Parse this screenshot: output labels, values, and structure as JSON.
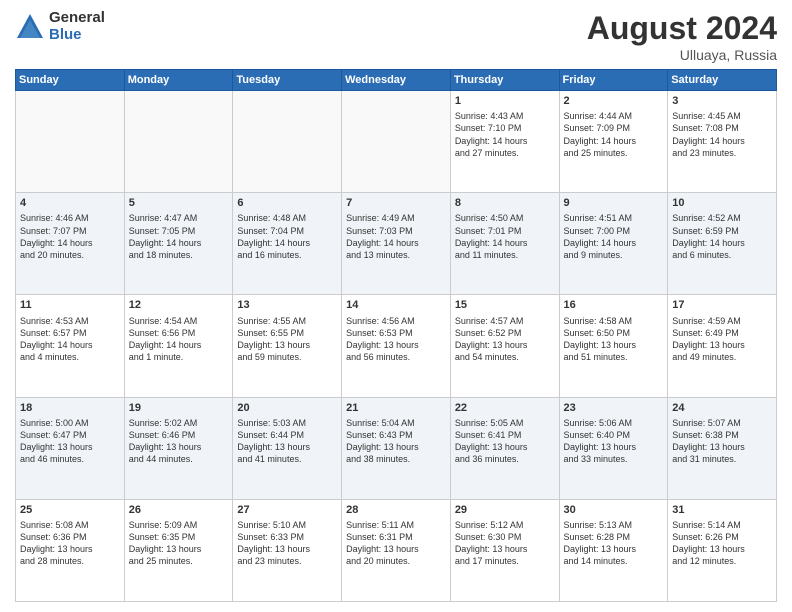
{
  "header": {
    "logo_general": "General",
    "logo_blue": "Blue",
    "month_title": "August 2024",
    "location": "Ulluaya, Russia"
  },
  "days_of_week": [
    "Sunday",
    "Monday",
    "Tuesday",
    "Wednesday",
    "Thursday",
    "Friday",
    "Saturday"
  ],
  "weeks": [
    [
      {
        "day": "",
        "info": ""
      },
      {
        "day": "",
        "info": ""
      },
      {
        "day": "",
        "info": ""
      },
      {
        "day": "",
        "info": ""
      },
      {
        "day": "1",
        "info": "Sunrise: 4:43 AM\nSunset: 7:10 PM\nDaylight: 14 hours\nand 27 minutes."
      },
      {
        "day": "2",
        "info": "Sunrise: 4:44 AM\nSunset: 7:09 PM\nDaylight: 14 hours\nand 25 minutes."
      },
      {
        "day": "3",
        "info": "Sunrise: 4:45 AM\nSunset: 7:08 PM\nDaylight: 14 hours\nand 23 minutes."
      }
    ],
    [
      {
        "day": "4",
        "info": "Sunrise: 4:46 AM\nSunset: 7:07 PM\nDaylight: 14 hours\nand 20 minutes."
      },
      {
        "day": "5",
        "info": "Sunrise: 4:47 AM\nSunset: 7:05 PM\nDaylight: 14 hours\nand 18 minutes."
      },
      {
        "day": "6",
        "info": "Sunrise: 4:48 AM\nSunset: 7:04 PM\nDaylight: 14 hours\nand 16 minutes."
      },
      {
        "day": "7",
        "info": "Sunrise: 4:49 AM\nSunset: 7:03 PM\nDaylight: 14 hours\nand 13 minutes."
      },
      {
        "day": "8",
        "info": "Sunrise: 4:50 AM\nSunset: 7:01 PM\nDaylight: 14 hours\nand 11 minutes."
      },
      {
        "day": "9",
        "info": "Sunrise: 4:51 AM\nSunset: 7:00 PM\nDaylight: 14 hours\nand 9 minutes."
      },
      {
        "day": "10",
        "info": "Sunrise: 4:52 AM\nSunset: 6:59 PM\nDaylight: 14 hours\nand 6 minutes."
      }
    ],
    [
      {
        "day": "11",
        "info": "Sunrise: 4:53 AM\nSunset: 6:57 PM\nDaylight: 14 hours\nand 4 minutes."
      },
      {
        "day": "12",
        "info": "Sunrise: 4:54 AM\nSunset: 6:56 PM\nDaylight: 14 hours\nand 1 minute."
      },
      {
        "day": "13",
        "info": "Sunrise: 4:55 AM\nSunset: 6:55 PM\nDaylight: 13 hours\nand 59 minutes."
      },
      {
        "day": "14",
        "info": "Sunrise: 4:56 AM\nSunset: 6:53 PM\nDaylight: 13 hours\nand 56 minutes."
      },
      {
        "day": "15",
        "info": "Sunrise: 4:57 AM\nSunset: 6:52 PM\nDaylight: 13 hours\nand 54 minutes."
      },
      {
        "day": "16",
        "info": "Sunrise: 4:58 AM\nSunset: 6:50 PM\nDaylight: 13 hours\nand 51 minutes."
      },
      {
        "day": "17",
        "info": "Sunrise: 4:59 AM\nSunset: 6:49 PM\nDaylight: 13 hours\nand 49 minutes."
      }
    ],
    [
      {
        "day": "18",
        "info": "Sunrise: 5:00 AM\nSunset: 6:47 PM\nDaylight: 13 hours\nand 46 minutes."
      },
      {
        "day": "19",
        "info": "Sunrise: 5:02 AM\nSunset: 6:46 PM\nDaylight: 13 hours\nand 44 minutes."
      },
      {
        "day": "20",
        "info": "Sunrise: 5:03 AM\nSunset: 6:44 PM\nDaylight: 13 hours\nand 41 minutes."
      },
      {
        "day": "21",
        "info": "Sunrise: 5:04 AM\nSunset: 6:43 PM\nDaylight: 13 hours\nand 38 minutes."
      },
      {
        "day": "22",
        "info": "Sunrise: 5:05 AM\nSunset: 6:41 PM\nDaylight: 13 hours\nand 36 minutes."
      },
      {
        "day": "23",
        "info": "Sunrise: 5:06 AM\nSunset: 6:40 PM\nDaylight: 13 hours\nand 33 minutes."
      },
      {
        "day": "24",
        "info": "Sunrise: 5:07 AM\nSunset: 6:38 PM\nDaylight: 13 hours\nand 31 minutes."
      }
    ],
    [
      {
        "day": "25",
        "info": "Sunrise: 5:08 AM\nSunset: 6:36 PM\nDaylight: 13 hours\nand 28 minutes."
      },
      {
        "day": "26",
        "info": "Sunrise: 5:09 AM\nSunset: 6:35 PM\nDaylight: 13 hours\nand 25 minutes."
      },
      {
        "day": "27",
        "info": "Sunrise: 5:10 AM\nSunset: 6:33 PM\nDaylight: 13 hours\nand 23 minutes."
      },
      {
        "day": "28",
        "info": "Sunrise: 5:11 AM\nSunset: 6:31 PM\nDaylight: 13 hours\nand 20 minutes."
      },
      {
        "day": "29",
        "info": "Sunrise: 5:12 AM\nSunset: 6:30 PM\nDaylight: 13 hours\nand 17 minutes."
      },
      {
        "day": "30",
        "info": "Sunrise: 5:13 AM\nSunset: 6:28 PM\nDaylight: 13 hours\nand 14 minutes."
      },
      {
        "day": "31",
        "info": "Sunrise: 5:14 AM\nSunset: 6:26 PM\nDaylight: 13 hours\nand 12 minutes."
      }
    ]
  ]
}
